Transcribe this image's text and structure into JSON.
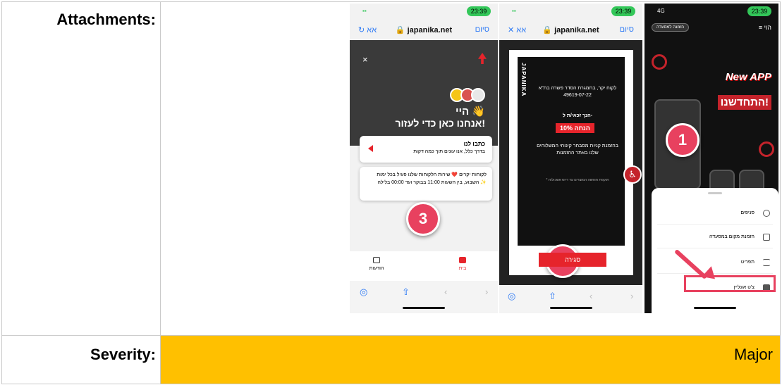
{
  "report": {
    "attachments_label": "Attachments:",
    "severity_label": "Severity:",
    "severity_value": "Major",
    "severity_color": "#ffc000"
  },
  "screenshots": {
    "phone1": {
      "time": "23:39",
      "url": "japanika.net",
      "url_left": "אא",
      "url_right": "סיום",
      "close": "×",
      "greeting": "היי 👋",
      "help_text": "אנחנו כאן כדי לעזור!",
      "card1_title": "כתבו לנו",
      "card1_sub": "בדרך כלל, אנו עונים תוך כמה דקות",
      "card2_text": "לקוחות יקרים ❤️ שירות הלקוחות שלנו פעיל בכל ימות השבוע, בין השעות 11:00 בבוקר ועד 00:00 בלילה ✨",
      "marker": "3",
      "tab_home": "בית",
      "tab_messages": "הודעות"
    },
    "phone2": {
      "time": "23:39",
      "url": "japanika.net",
      "url_left": "אא",
      "url_right": "סיום",
      "brand_vertical": "JAPANIKA",
      "promo_intro": "לקוח יקר, בתמגרת הסדר פשרה בת\"א 49619-07-22",
      "promo_win": "הנך זכאי/ת ל-",
      "promo_discount": "10% הנחה",
      "promo_body": "בהזמנת קניות מסבחר קינוחי המשלוחים שלנו באתר ההזמנות",
      "promo_fine": "* תוקפת חופשה המוצרים עד דיוס אשכולות",
      "marker": "2",
      "close_button": "סגירה"
    },
    "phone3": {
      "time": "23:39",
      "signal": "4G",
      "order_pill": "הזמנה למסעדה",
      "menu_label": "הוי",
      "headline_1": "New APP",
      "headline_2": "התחדשנו!",
      "marker": "1",
      "menu_items": [
        "סניפים",
        "הזמנת מקום במסעדה",
        "תפריט",
        "צ'ט אונליין"
      ]
    }
  }
}
